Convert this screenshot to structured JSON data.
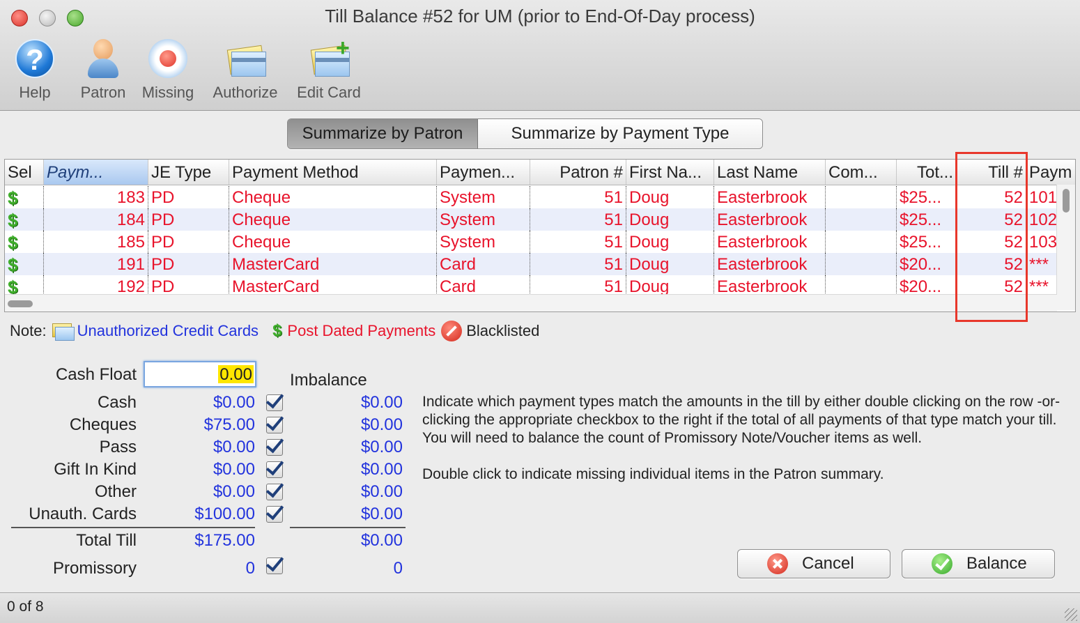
{
  "window": {
    "title": "Till Balance #52 for UM (prior to End-Of-Day process)"
  },
  "toolbar": {
    "help": "Help",
    "patron": "Patron",
    "missing": "Missing",
    "authorize": "Authorize",
    "edit_card": "Edit Card"
  },
  "tabs": {
    "by_patron": "Summarize by Patron",
    "by_payment_type": "Summarize by Payment Type"
  },
  "table": {
    "columns": [
      "Sel",
      "Paym...",
      "JE Type",
      "Payment Method",
      "Paymen...",
      "Patron #",
      "First Na...",
      "Last Name",
      "Com...",
      "Tot...",
      "Till #",
      "Paym"
    ],
    "rows": [
      [
        "$",
        "183",
        "PD",
        "Cheque",
        "System",
        "51",
        "Doug",
        "Easterbrook",
        "",
        "$25...",
        "52",
        "101"
      ],
      [
        "$",
        "184",
        "PD",
        "Cheque",
        "System",
        "51",
        "Doug",
        "Easterbrook",
        "",
        "$25...",
        "52",
        "102"
      ],
      [
        "$",
        "185",
        "PD",
        "Cheque",
        "System",
        "51",
        "Doug",
        "Easterbrook",
        "",
        "$25...",
        "52",
        "103"
      ],
      [
        "$",
        "191",
        "PD",
        "MasterCard",
        "Card",
        "51",
        "Doug",
        "Easterbrook",
        "",
        "$20...",
        "52",
        "***"
      ],
      [
        "$",
        "192",
        "PD",
        "MasterCard",
        "Card",
        "51",
        "Doug",
        "Easterbrook",
        "",
        "$20...",
        "52",
        "***"
      ]
    ]
  },
  "note": {
    "label": "Note:",
    "unauthorized": "Unauthorized Credit Cards",
    "post_dated": "Post Dated Payments",
    "blacklisted": "Blacklisted"
  },
  "balance": {
    "cash_float_label": "Cash Float",
    "cash_float_value": "0.00",
    "imbalance_label": "Imbalance",
    "items": [
      {
        "label": "Cash",
        "amount": "$0.00",
        "imbalance": "$0.00"
      },
      {
        "label": "Cheques",
        "amount": "$75.00",
        "imbalance": "$0.00"
      },
      {
        "label": "Pass",
        "amount": "$0.00",
        "imbalance": "$0.00"
      },
      {
        "label": "Gift In Kind",
        "amount": "$0.00",
        "imbalance": "$0.00"
      },
      {
        "label": "Other",
        "amount": "$0.00",
        "imbalance": "$0.00"
      },
      {
        "label": "Unauth. Cards",
        "amount": "$100.00",
        "imbalance": "$0.00"
      }
    ],
    "total_label": "Total Till",
    "total_amount": "$175.00",
    "total_imbalance": "$0.00",
    "promissory_label": "Promissory",
    "promissory_amount": "0",
    "promissory_imbalance": "0"
  },
  "description": {
    "p1": "Indicate which payment types match the amounts in the till by either double clicking on the row -or- clicking the appropriate checkbox to the right if the total of all payments of that type match your till.   You will need to balance the count of Promissory Note/Voucher items as well.",
    "p2": "Double click to indicate missing individual items in the Patron summary."
  },
  "buttons": {
    "cancel": "Cancel",
    "balance": "Balance"
  },
  "status": {
    "text": "0 of 8"
  },
  "colors": {
    "row_text": "#e8132b",
    "amount_text": "#2233dd",
    "highlight_box": "#e8372b",
    "cash_float_fill": "#ffe600"
  }
}
